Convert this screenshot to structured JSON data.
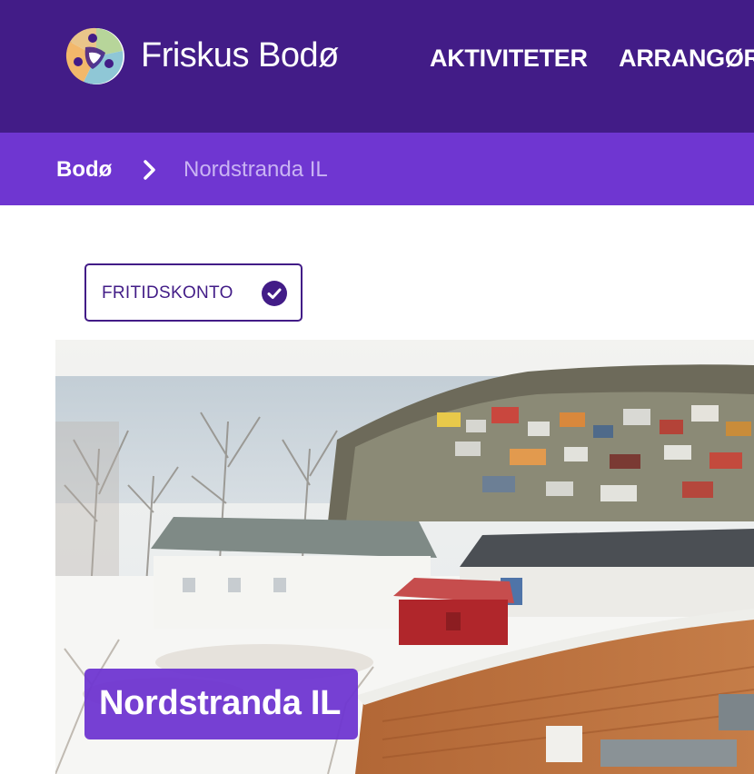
{
  "header": {
    "brand_name": "Friskus Bodø",
    "logo_icon": "friskus-logo-icon",
    "nav": [
      {
        "label": "AKTIVITETER"
      },
      {
        "label": "ARRANGØR"
      }
    ]
  },
  "breadcrumb": {
    "root": "Bodø",
    "separator_icon": "chevron-right-icon",
    "current": "Nordstranda IL"
  },
  "badge": {
    "label": "FRITIDSKONTO",
    "icon": "check-circle-icon"
  },
  "hero": {
    "title": "Nordstranda IL",
    "image": "hero-landscape-image"
  },
  "colors": {
    "header_bg": "#421c87",
    "breadcrumb_bg": "#6f36d1",
    "breadcrumb_current": "#c9b3f3",
    "badge_border": "#421c87",
    "title_box": "#6f36d1"
  }
}
